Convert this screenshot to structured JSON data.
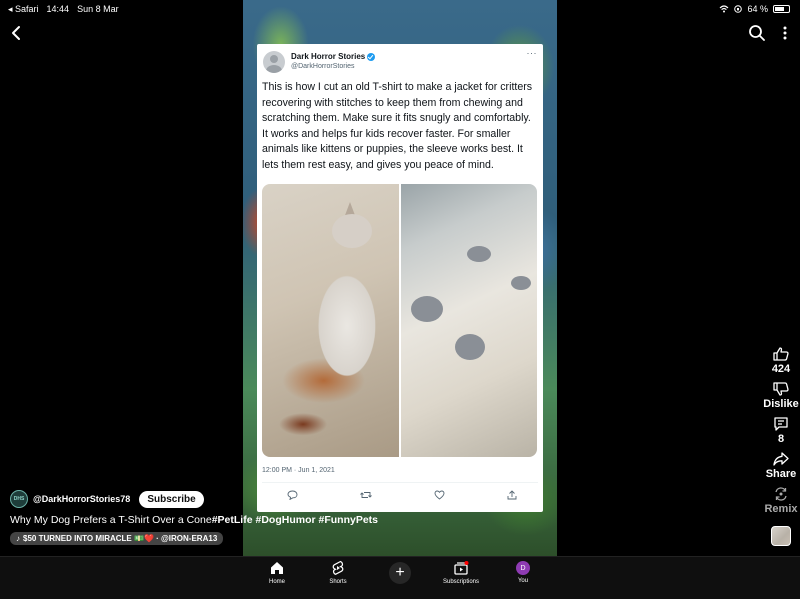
{
  "status_bar": {
    "back_app": "◂ Safari",
    "time": "14:44",
    "date": "Sun 8 Mar",
    "battery": "64 %"
  },
  "tweet": {
    "name": "Dark Horror Stories",
    "handle": "@DarkHorrorStories",
    "more": "···",
    "text": "This is how I cut an old T-shirt to make a jacket for critters recovering with stitches to keep them from chewing and scratching them. Make sure it fits snugly and comfortably. It works and helps fur kids recover faster. For smaller animals like kittens or puppies, the sleeve works best. It lets them rest easy, and gives you peace of mind.",
    "timestamp": "12:00 PM · Jun 1, 2021"
  },
  "rail": {
    "likes": "424",
    "dislike_label": "Dislike",
    "comments": "8",
    "share_label": "Share",
    "remix_label": "Remix"
  },
  "channel": {
    "avatar_text": "DHS",
    "name": "@DarkHorrorStories78",
    "subscribe_label": "Subscribe"
  },
  "video_title": {
    "plain": "Why My Dog Prefers a T-Shirt Over a Cone",
    "tags": "#PetLife #DogHumor #FunnyPets"
  },
  "sound": {
    "note": "♪",
    "label": "$50 TURNED INTO MIRACLE 💵❤️ · @IRON-ERA13"
  },
  "nav": {
    "home": "Home",
    "shorts": "Shorts",
    "create": "+",
    "subscriptions": "Subscriptions",
    "you": "You",
    "you_initial": "D"
  },
  "icons": {
    "back": "chevron-left-icon",
    "search": "search-icon",
    "more": "more-vert-icon",
    "like": "thumb-up-icon",
    "dislike": "thumb-down-icon",
    "comment": "comment-icon",
    "share": "share-icon",
    "remix": "remix-icon"
  }
}
